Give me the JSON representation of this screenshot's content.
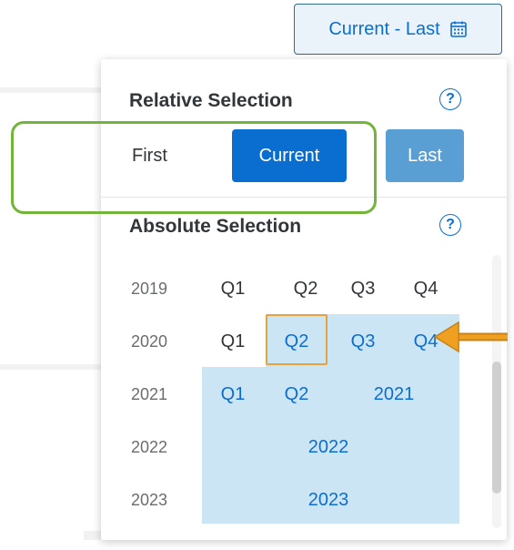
{
  "trigger": {
    "label": "Current - Last",
    "icon": "calendar-icon"
  },
  "relative": {
    "title": "Relative Selection",
    "options": {
      "first": "First",
      "current": "Current",
      "last": "Last"
    },
    "selected": "current",
    "help_icon": "help-icon"
  },
  "absolute": {
    "title": "Absolute Selection",
    "help_icon": "help-icon",
    "rows": [
      {
        "year": "2019",
        "cells": [
          "Q1",
          "Q2",
          "Q3",
          "Q4"
        ]
      },
      {
        "year": "2020",
        "cells": [
          "Q1",
          "Q2",
          "Q3",
          "Q4"
        ]
      },
      {
        "year": "2021",
        "cells": [
          "Q1",
          "Q2",
          "2021"
        ]
      },
      {
        "year": "2022",
        "cells": [
          "2022"
        ]
      },
      {
        "year": "2023",
        "cells": [
          "2023"
        ]
      }
    ],
    "focused": "2020 Q2"
  },
  "colors": {
    "accent": "#0a6ed1",
    "range_highlight": "#cce5f5",
    "focus_border": "#e7a33b",
    "annotation_green": "#72b53a",
    "annotation_arrow": "#f0a020"
  }
}
